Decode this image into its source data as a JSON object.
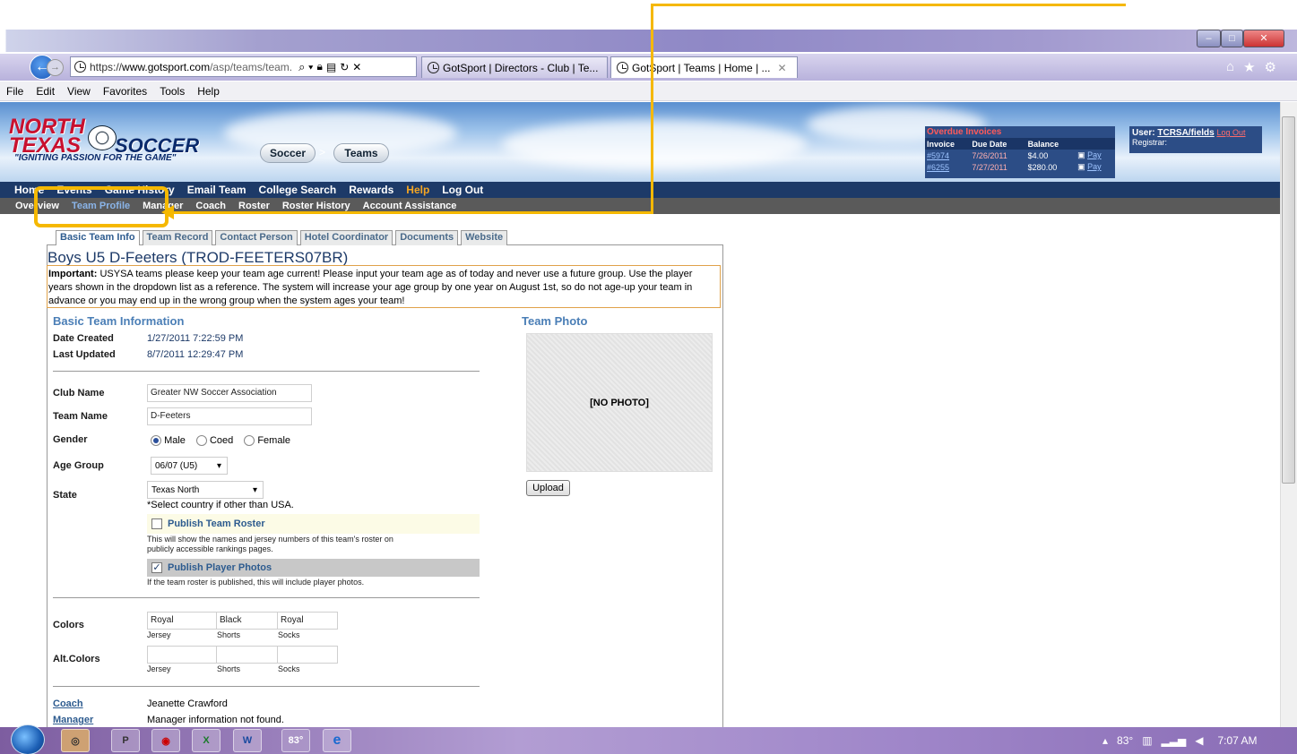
{
  "browser": {
    "url_prefix": "https://",
    "url_host": "www.gotsport.com",
    "url_path": "/asp/teams/team.",
    "tabs": [
      {
        "label": "GotSport | Directors - Club | Te..."
      },
      {
        "label": "GotSport | Teams | Home | ..."
      }
    ],
    "menu": [
      "File",
      "Edit",
      "View",
      "Favorites",
      "Tools",
      "Help"
    ]
  },
  "site": {
    "logo_top": "NORTH\nTEXAS",
    "logo_word": "SOCCER",
    "tagline": "\"IGNITING PASSION FOR THE GAME\"",
    "crumbs": [
      "Soccer",
      "Teams"
    ],
    "overdue": {
      "title": "Overdue Invoices",
      "headers": [
        "Invoice",
        "Due Date",
        "Balance"
      ],
      "rows": [
        {
          "invoice": "#5974",
          "due": "7/26/2011",
          "balance": "$4.00",
          "pay": "Pay"
        },
        {
          "invoice": "#6255",
          "due": "7/27/2011",
          "balance": "$280.00",
          "pay": "Pay"
        }
      ]
    },
    "user": {
      "label": "User:",
      "name": "TCRSA/fields",
      "logout": "Log Out",
      "registrar": "Registrar:"
    }
  },
  "nav1": [
    "Home",
    "Events",
    "Game History",
    "Email Team",
    "College Search",
    "Rewards",
    "Help",
    "Log Out"
  ],
  "nav2": [
    "Overview",
    "Team Profile",
    "Manager",
    "Coach",
    "Roster",
    "Roster History",
    "Account Assistance"
  ],
  "content_tabs": [
    "Basic Team Info",
    "Team Record",
    "Contact Person",
    "Hotel Coordinator",
    "Documents",
    "Website"
  ],
  "page": {
    "title": "Boys U5 D-Feeters (TROD-FEETERS07BR)",
    "important_label": "Important:",
    "important_text": " USYSA teams please keep your team age current! Please input your team age as of today and never use a future group. Use the player years shown in the dropdown list as a reference. The system will increase your age group by one year on August 1st, so do not age-up your team in advance or you may end up in the wrong group when the system ages your team!"
  },
  "basic_info": {
    "header": "Basic Team Information",
    "date_created_label": "Date Created",
    "date_created": "1/27/2011 7:22:59 PM",
    "last_updated_label": "Last Updated",
    "last_updated": "8/7/2011 12:29:47 PM",
    "club_name_label": "Club Name",
    "club_name": "Greater NW Soccer Association",
    "team_name_label": "Team Name",
    "team_name": "D-Feeters",
    "gender_label": "Gender",
    "gender_options": [
      "Male",
      "Coed",
      "Female"
    ],
    "gender_selected": "Male",
    "age_group_label": "Age Group",
    "age_group": "06/07 (U5)",
    "state_label": "State",
    "state": "Texas North",
    "state_note": "*Select country if other than USA.",
    "publish_roster_label": "Publish Team Roster",
    "publish_roster_note": "This will show the names and jersey numbers of this team's roster on publicly accessible rankings pages.",
    "publish_roster_checked": false,
    "publish_photos_label": "Publish Player Photos",
    "publish_photos_note": "If the team roster is published, this will include player photos.",
    "publish_photos_checked": true,
    "colors_label": "Colors",
    "colors": {
      "jersey": "Royal",
      "shorts": "Black",
      "socks": "Royal"
    },
    "alt_colors_label": "Alt.Colors",
    "alt_colors": {
      "jersey": "",
      "shorts": "",
      "socks": ""
    },
    "sub_labels": {
      "jersey": "Jersey",
      "shorts": "Shorts",
      "socks": "Socks"
    },
    "coach_label": "Coach",
    "coach": "Jeanette Crawford",
    "manager_label": "Manager",
    "manager": "Manager information not found."
  },
  "photo": {
    "header": "Team Photo",
    "placeholder": "[NO PHOTO]",
    "upload": "Upload"
  },
  "taskbar": {
    "weather": "83°",
    "tray_temp": "83°",
    "time": "7:07 AM"
  }
}
